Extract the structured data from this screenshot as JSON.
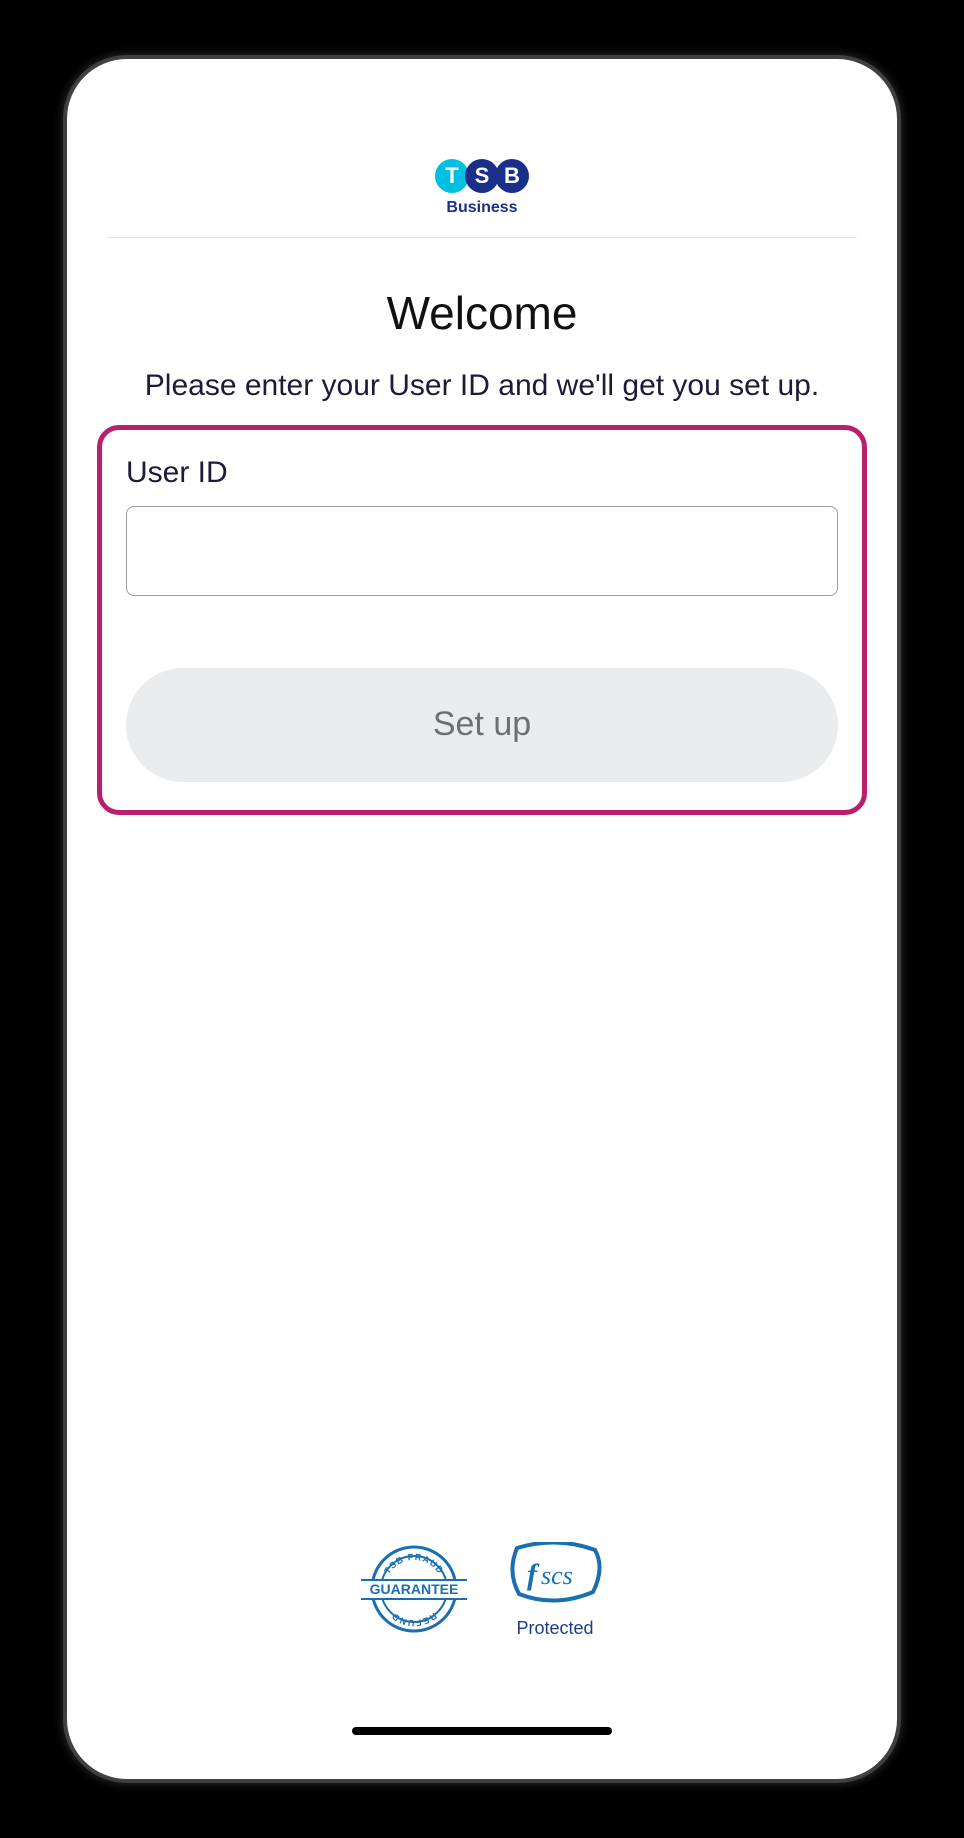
{
  "brand": {
    "letter_t": "T",
    "letter_s": "S",
    "letter_b": "B",
    "subline": "Business"
  },
  "heading": "Welcome",
  "subheading": "Please enter your User ID and we'll get you set up.",
  "form": {
    "user_id_label": "User ID",
    "user_id_value": "",
    "submit_label": "Set up"
  },
  "footer": {
    "guarantee_top": "TSB FRAUD",
    "guarantee_mid": "GUARANTEE",
    "guarantee_bottom": "REFUND",
    "fscs_caption": "Protected"
  }
}
